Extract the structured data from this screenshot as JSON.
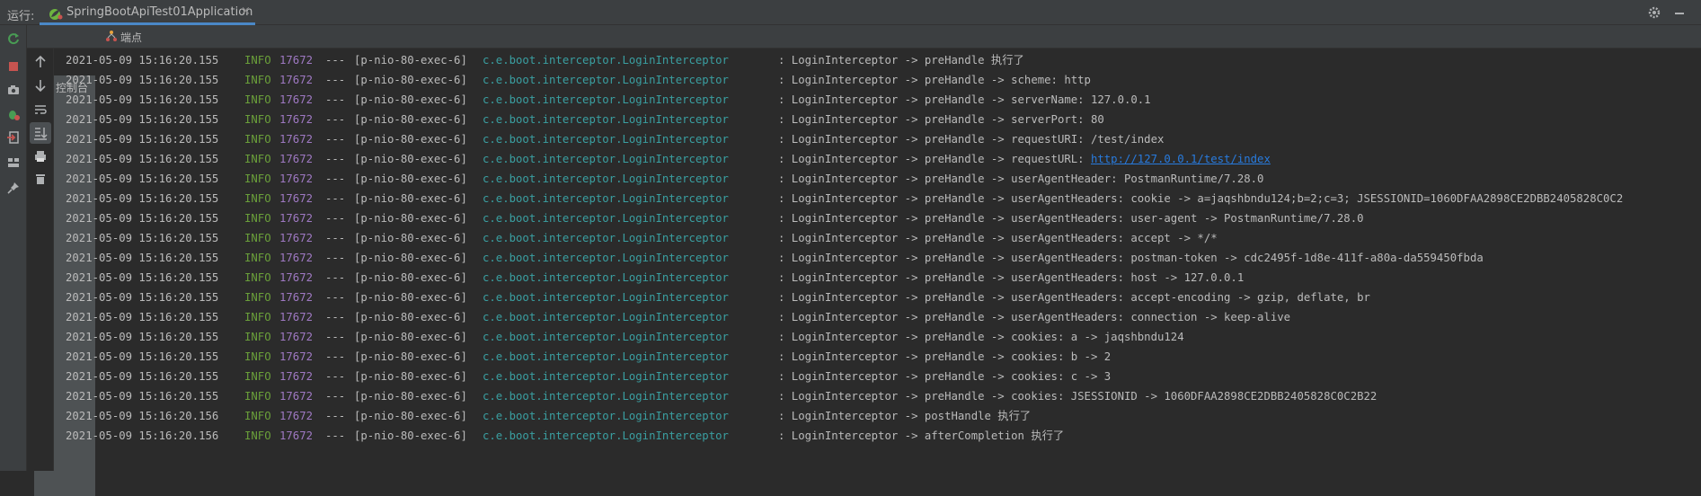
{
  "titlebar": {
    "run_label": "运行:",
    "tab_title": "SpringBootApiTest01Application",
    "close_glyph": "×"
  },
  "subtabs": {
    "console_label": "控制台",
    "endpoints_label": "端点"
  },
  "colors": {
    "info": "#6a9f3a",
    "pid": "#9f79c3",
    "class": "#3a9fa1",
    "link": "#287bde",
    "tab_underline": "#4a88c7",
    "stop_red": "#c75450",
    "rerun_green": "#499c54"
  },
  "icons": [
    "rerun-icon",
    "stop-icon",
    "camera-icon",
    "debug-icon",
    "exit-icon",
    "layout-icon",
    "pin-icon",
    "up-arrow-icon",
    "down-arrow-icon",
    "soft-wrap-icon",
    "scroll-to-end-icon",
    "print-icon",
    "trash-icon",
    "settings-icon",
    "minimize-icon",
    "spring-icon",
    "console-icon",
    "endpoints-icon"
  ],
  "log": [
    {
      "ts": "2021-05-09 15:16:20.155",
      "level": "INFO",
      "pid": "17672",
      "sep": "---",
      "thread": "[p-nio-80-exec-6]",
      "cls": "c.e.boot.interceptor.LoginInterceptor",
      "msg": ": LoginInterceptor -> preHandle 执行了"
    },
    {
      "ts": "2021-05-09 15:16:20.155",
      "level": "INFO",
      "pid": "17672",
      "sep": "---",
      "thread": "[p-nio-80-exec-6]",
      "cls": "c.e.boot.interceptor.LoginInterceptor",
      "msg": ": LoginInterceptor -> preHandle -> scheme: http"
    },
    {
      "ts": "2021-05-09 15:16:20.155",
      "level": "INFO",
      "pid": "17672",
      "sep": "---",
      "thread": "[p-nio-80-exec-6]",
      "cls": "c.e.boot.interceptor.LoginInterceptor",
      "msg": ": LoginInterceptor -> preHandle -> serverName: 127.0.0.1"
    },
    {
      "ts": "2021-05-09 15:16:20.155",
      "level": "INFO",
      "pid": "17672",
      "sep": "---",
      "thread": "[p-nio-80-exec-6]",
      "cls": "c.e.boot.interceptor.LoginInterceptor",
      "msg": ": LoginInterceptor -> preHandle -> serverPort: 80"
    },
    {
      "ts": "2021-05-09 15:16:20.155",
      "level": "INFO",
      "pid": "17672",
      "sep": "---",
      "thread": "[p-nio-80-exec-6]",
      "cls": "c.e.boot.interceptor.LoginInterceptor",
      "msg": ": LoginInterceptor -> preHandle -> requestURI: /test/index"
    },
    {
      "ts": "2021-05-09 15:16:20.155",
      "level": "INFO",
      "pid": "17672",
      "sep": "---",
      "thread": "[p-nio-80-exec-6]",
      "cls": "c.e.boot.interceptor.LoginInterceptor",
      "msg": ": LoginInterceptor -> preHandle -> requestURL: ",
      "link": "http://127.0.0.1/test/index"
    },
    {
      "ts": "2021-05-09 15:16:20.155",
      "level": "INFO",
      "pid": "17672",
      "sep": "---",
      "thread": "[p-nio-80-exec-6]",
      "cls": "c.e.boot.interceptor.LoginInterceptor",
      "msg": ": LoginInterceptor -> preHandle -> userAgentHeader: PostmanRuntime/7.28.0"
    },
    {
      "ts": "2021-05-09 15:16:20.155",
      "level": "INFO",
      "pid": "17672",
      "sep": "---",
      "thread": "[p-nio-80-exec-6]",
      "cls": "c.e.boot.interceptor.LoginInterceptor",
      "msg": ": LoginInterceptor -> preHandle -> userAgentHeaders: cookie -> a=jaqshbndu124;b=2;c=3; JSESSIONID=1060DFAA2898CE2DBB2405828C0C2"
    },
    {
      "ts": "2021-05-09 15:16:20.155",
      "level": "INFO",
      "pid": "17672",
      "sep": "---",
      "thread": "[p-nio-80-exec-6]",
      "cls": "c.e.boot.interceptor.LoginInterceptor",
      "msg": ": LoginInterceptor -> preHandle -> userAgentHeaders: user-agent -> PostmanRuntime/7.28.0"
    },
    {
      "ts": "2021-05-09 15:16:20.155",
      "level": "INFO",
      "pid": "17672",
      "sep": "---",
      "thread": "[p-nio-80-exec-6]",
      "cls": "c.e.boot.interceptor.LoginInterceptor",
      "msg": ": LoginInterceptor -> preHandle -> userAgentHeaders: accept -> */*"
    },
    {
      "ts": "2021-05-09 15:16:20.155",
      "level": "INFO",
      "pid": "17672",
      "sep": "---",
      "thread": "[p-nio-80-exec-6]",
      "cls": "c.e.boot.interceptor.LoginInterceptor",
      "msg": ": LoginInterceptor -> preHandle -> userAgentHeaders: postman-token -> cdc2495f-1d8e-411f-a80a-da559450fbda"
    },
    {
      "ts": "2021-05-09 15:16:20.155",
      "level": "INFO",
      "pid": "17672",
      "sep": "---",
      "thread": "[p-nio-80-exec-6]",
      "cls": "c.e.boot.interceptor.LoginInterceptor",
      "msg": ": LoginInterceptor -> preHandle -> userAgentHeaders: host -> 127.0.0.1"
    },
    {
      "ts": "2021-05-09 15:16:20.155",
      "level": "INFO",
      "pid": "17672",
      "sep": "---",
      "thread": "[p-nio-80-exec-6]",
      "cls": "c.e.boot.interceptor.LoginInterceptor",
      "msg": ": LoginInterceptor -> preHandle -> userAgentHeaders: accept-encoding -> gzip, deflate, br"
    },
    {
      "ts": "2021-05-09 15:16:20.155",
      "level": "INFO",
      "pid": "17672",
      "sep": "---",
      "thread": "[p-nio-80-exec-6]",
      "cls": "c.e.boot.interceptor.LoginInterceptor",
      "msg": ": LoginInterceptor -> preHandle -> userAgentHeaders: connection -> keep-alive"
    },
    {
      "ts": "2021-05-09 15:16:20.155",
      "level": "INFO",
      "pid": "17672",
      "sep": "---",
      "thread": "[p-nio-80-exec-6]",
      "cls": "c.e.boot.interceptor.LoginInterceptor",
      "msg": ": LoginInterceptor -> preHandle -> cookies: a -> jaqshbndu124"
    },
    {
      "ts": "2021-05-09 15:16:20.155",
      "level": "INFO",
      "pid": "17672",
      "sep": "---",
      "thread": "[p-nio-80-exec-6]",
      "cls": "c.e.boot.interceptor.LoginInterceptor",
      "msg": ": LoginInterceptor -> preHandle -> cookies: b -> 2"
    },
    {
      "ts": "2021-05-09 15:16:20.155",
      "level": "INFO",
      "pid": "17672",
      "sep": "---",
      "thread": "[p-nio-80-exec-6]",
      "cls": "c.e.boot.interceptor.LoginInterceptor",
      "msg": ": LoginInterceptor -> preHandle -> cookies: c -> 3"
    },
    {
      "ts": "2021-05-09 15:16:20.155",
      "level": "INFO",
      "pid": "17672",
      "sep": "---",
      "thread": "[p-nio-80-exec-6]",
      "cls": "c.e.boot.interceptor.LoginInterceptor",
      "msg": ": LoginInterceptor -> preHandle -> cookies: JSESSIONID -> 1060DFAA2898CE2DBB2405828C0C2B22"
    },
    {
      "ts": "2021-05-09 15:16:20.156",
      "level": "INFO",
      "pid": "17672",
      "sep": "---",
      "thread": "[p-nio-80-exec-6]",
      "cls": "c.e.boot.interceptor.LoginInterceptor",
      "msg": ": LoginInterceptor -> postHandle 执行了"
    },
    {
      "ts": "2021-05-09 15:16:20.156",
      "level": "INFO",
      "pid": "17672",
      "sep": "---",
      "thread": "[p-nio-80-exec-6]",
      "cls": "c.e.boot.interceptor.LoginInterceptor",
      "msg": ": LoginInterceptor -> afterCompletion 执行了"
    }
  ]
}
